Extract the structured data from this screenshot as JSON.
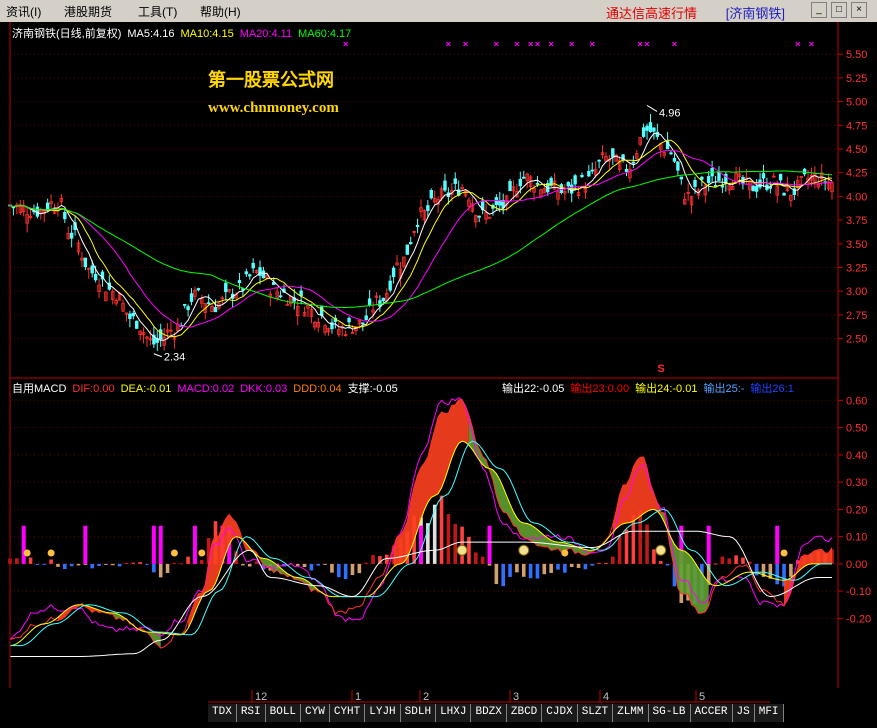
{
  "menu": [
    "资讯(I)",
    "港股期货",
    "工具(T)",
    "帮助(H)"
  ],
  "app": {
    "title": "通达信高速行情",
    "stock_tag": "[济南钢铁]"
  },
  "watermark": {
    "line1": "第一股票公式网",
    "line2": "www.chnmoney.com"
  },
  "colors": {
    "up": "#ff3030",
    "down": "#54ffff",
    "ma5": "#ffffff",
    "ma10": "#ffff00",
    "ma20": "#ff00ff",
    "ma60": "#00ff00",
    "axis": "#c00000"
  },
  "price_header": [
    {
      "text": "济南钢铁(日线,前复权)",
      "color": "#ffffff"
    },
    {
      "text": "MA5:4.16",
      "color": "#ffffff"
    },
    {
      "text": "MA10:4.15",
      "color": "#ffff00"
    },
    {
      "text": "MA20:4.11",
      "color": "#ff00ff"
    },
    {
      "text": "MA60:4.17",
      "color": "#00ff00"
    }
  ],
  "macd_header": [
    {
      "text": "自用MACD",
      "color": "#ffffff"
    },
    {
      "text": "DIF:0.00",
      "color": "#ff3030"
    },
    {
      "text": "DEA:-0.01",
      "color": "#ffff00"
    },
    {
      "text": "MACD:0.02",
      "color": "#ff00ff"
    },
    {
      "text": "DKK:0.03",
      "color": "#ff00ff"
    },
    {
      "text": "DDD:0.04",
      "color": "#ff8000"
    },
    {
      "text": "支撑:-0.05",
      "color": "#ffffff"
    }
  ],
  "macd_header_right": [
    {
      "text": "输出22:-0.05",
      "color": "#ffffff"
    },
    {
      "text": "输出23:0.00",
      "color": "#ff0000"
    },
    {
      "text": "输出24:-0.01",
      "color": "#ffff00"
    },
    {
      "text": "输出25:-",
      "color": "#54a0ff"
    },
    {
      "text": "输出26:1",
      "color": "#2040ff"
    }
  ],
  "price_annotations": {
    "high": "4.96",
    "low": "2.34",
    "signal": "S"
  },
  "month_labels": [
    "12",
    "1",
    "2",
    "3",
    "4",
    "5"
  ],
  "tabs": [
    "TDX",
    "RSI",
    "BOLL",
    "CYW",
    "CYHT",
    "LYJH",
    "SDLH",
    "LHXJ",
    "BDZX",
    "ZBCD",
    "CJDX",
    "SLZT",
    "ZLMM",
    "SG-LB",
    "ACCER",
    "JS",
    "MFI"
  ],
  "chart_data": [
    {
      "type": "candlestick",
      "title": "济南钢铁(日线,前复权)",
      "y_ticks": [
        2.5,
        2.75,
        3.0,
        3.25,
        3.5,
        3.75,
        4.0,
        4.25,
        4.5,
        4.75,
        5.0,
        5.25,
        5.5
      ],
      "y_tick_labels": [
        "2.50",
        "2.75",
        "3.00",
        "3.25",
        "3.50",
        "3.75",
        "4.00",
        "4.25",
        "4.50",
        "4.75",
        "5.00",
        "5.25",
        "5.50"
      ],
      "ylim": [
        2.2,
        5.65
      ],
      "grid": true,
      "close_key": [
        [
          0,
          3.9
        ],
        [
          8,
          3.85
        ],
        [
          14,
          3.95
        ],
        [
          18,
          3.6
        ],
        [
          24,
          3.2
        ],
        [
          30,
          3.0
        ],
        [
          36,
          2.7
        ],
        [
          42,
          2.45
        ],
        [
          48,
          2.6
        ],
        [
          54,
          2.95
        ],
        [
          60,
          2.85
        ],
        [
          66,
          3.0
        ],
        [
          72,
          3.2
        ],
        [
          78,
          3.0
        ],
        [
          84,
          2.9
        ],
        [
          90,
          2.75
        ],
        [
          96,
          2.6
        ],
        [
          102,
          2.65
        ],
        [
          108,
          2.9
        ],
        [
          114,
          3.3
        ],
        [
          120,
          3.8
        ],
        [
          126,
          4.0
        ],
        [
          132,
          4.1
        ],
        [
          138,
          3.8
        ],
        [
          144,
          3.9
        ],
        [
          150,
          4.2
        ],
        [
          156,
          4.1
        ],
        [
          162,
          4.05
        ],
        [
          168,
          4.15
        ],
        [
          174,
          4.4
        ],
        [
          180,
          4.3
        ],
        [
          186,
          4.7
        ],
        [
          192,
          4.5
        ],
        [
          198,
          4.0
        ],
        [
          204,
          4.15
        ],
        [
          210,
          4.2
        ],
        [
          216,
          4.1
        ],
        [
          222,
          4.15
        ],
        [
          228,
          4.05
        ],
        [
          234,
          4.2
        ],
        [
          240,
          4.15
        ]
      ],
      "ma_series": [
        {
          "name": "MA5",
          "value": 4.16
        },
        {
          "name": "MA10",
          "value": 4.15
        },
        {
          "name": "MA20",
          "value": 4.11
        },
        {
          "name": "MA60",
          "value": 4.17
        }
      ],
      "annotations": [
        {
          "text": "4.96",
          "y": 4.96
        },
        {
          "text": "2.34",
          "y": 2.34
        }
      ]
    },
    {
      "type": "macd",
      "title": "自用MACD",
      "y_ticks": [
        -0.2,
        -0.1,
        0.0,
        0.1,
        0.2,
        0.3,
        0.4,
        0.5,
        0.6
      ],
      "y_tick_labels": [
        "-0.20",
        "-0.10",
        "0.00",
        "0.10",
        "0.20",
        "0.30",
        "0.40",
        "0.50",
        "0.60"
      ],
      "ylim": [
        -0.36,
        0.66
      ],
      "dif_key": [
        [
          0,
          -0.28
        ],
        [
          8,
          -0.22
        ],
        [
          14,
          -0.2
        ],
        [
          20,
          -0.15
        ],
        [
          26,
          -0.18
        ],
        [
          32,
          -0.2
        ],
        [
          38,
          -0.24
        ],
        [
          44,
          -0.3
        ],
        [
          50,
          -0.25
        ],
        [
          56,
          -0.1
        ],
        [
          60,
          0.1
        ],
        [
          64,
          0.18
        ],
        [
          70,
          0.05
        ],
        [
          76,
          -0.02
        ],
        [
          82,
          -0.05
        ],
        [
          90,
          -0.1
        ],
        [
          96,
          -0.18
        ],
        [
          102,
          -0.15
        ],
        [
          108,
          -0.05
        ],
        [
          114,
          0.1
        ],
        [
          120,
          0.35
        ],
        [
          126,
          0.55
        ],
        [
          132,
          0.6
        ],
        [
          138,
          0.4
        ],
        [
          144,
          0.2
        ],
        [
          150,
          0.1
        ],
        [
          156,
          0.06
        ],
        [
          162,
          0.05
        ],
        [
          168,
          0.04
        ],
        [
          174,
          0.08
        ],
        [
          180,
          0.3
        ],
        [
          184,
          0.4
        ],
        [
          190,
          0.2
        ],
        [
          196,
          -0.1
        ],
        [
          202,
          -0.18
        ],
        [
          208,
          -0.05
        ],
        [
          214,
          0.0
        ],
        [
          220,
          -0.1
        ],
        [
          226,
          -0.15
        ],
        [
          232,
          0.04
        ],
        [
          240,
          0.05
        ]
      ],
      "dea_key": [
        [
          0,
          -0.3
        ],
        [
          10,
          -0.22
        ],
        [
          20,
          -0.15
        ],
        [
          30,
          -0.18
        ],
        [
          40,
          -0.25
        ],
        [
          50,
          -0.26
        ],
        [
          58,
          -0.1
        ],
        [
          66,
          0.1
        ],
        [
          74,
          0.02
        ],
        [
          84,
          -0.05
        ],
        [
          94,
          -0.12
        ],
        [
          104,
          -0.12
        ],
        [
          114,
          0.0
        ],
        [
          124,
          0.25
        ],
        [
          132,
          0.45
        ],
        [
          140,
          0.35
        ],
        [
          150,
          0.15
        ],
        [
          160,
          0.08
        ],
        [
          170,
          0.05
        ],
        [
          180,
          0.15
        ],
        [
          188,
          0.2
        ],
        [
          196,
          0.05
        ],
        [
          206,
          -0.08
        ],
        [
          216,
          -0.03
        ],
        [
          226,
          -0.06
        ],
        [
          234,
          0.0
        ],
        [
          240,
          0.0
        ]
      ],
      "support_key": [
        [
          0,
          -0.34
        ],
        [
          20,
          -0.34
        ],
        [
          36,
          -0.33
        ],
        [
          44,
          -0.28
        ],
        [
          56,
          -0.12
        ],
        [
          70,
          0.05
        ],
        [
          76,
          -0.05
        ],
        [
          90,
          -0.08
        ],
        [
          100,
          -0.12
        ],
        [
          110,
          0.02
        ],
        [
          124,
          0.05
        ],
        [
          132,
          0.08
        ],
        [
          150,
          0.08
        ],
        [
          170,
          0.06
        ],
        [
          182,
          0.12
        ],
        [
          200,
          0.12
        ],
        [
          210,
          0.1
        ],
        [
          222,
          -0.12
        ],
        [
          236,
          -0.05
        ],
        [
          240,
          -0.05
        ]
      ]
    }
  ]
}
